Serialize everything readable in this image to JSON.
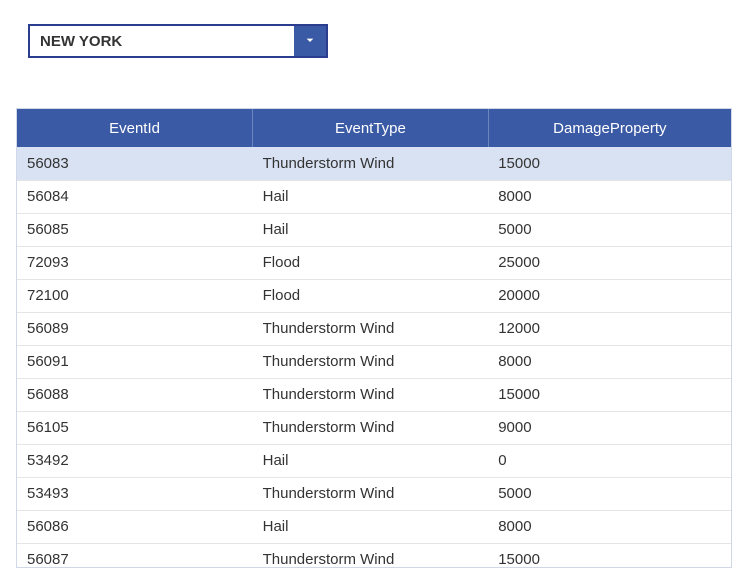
{
  "dropdown": {
    "value": "NEW YORK"
  },
  "table": {
    "columns": [
      "EventId",
      "EventType",
      "DamageProperty"
    ],
    "rows": [
      {
        "EventId": "56083",
        "EventType": "Thunderstorm Wind",
        "DamageProperty": "15000",
        "selected": true
      },
      {
        "EventId": "56084",
        "EventType": "Hail",
        "DamageProperty": "8000"
      },
      {
        "EventId": "56085",
        "EventType": "Hail",
        "DamageProperty": "5000"
      },
      {
        "EventId": "72093",
        "EventType": "Flood",
        "DamageProperty": "25000"
      },
      {
        "EventId": "72100",
        "EventType": "Flood",
        "DamageProperty": "20000"
      },
      {
        "EventId": "56089",
        "EventType": "Thunderstorm Wind",
        "DamageProperty": "12000"
      },
      {
        "EventId": "56091",
        "EventType": "Thunderstorm Wind",
        "DamageProperty": "8000"
      },
      {
        "EventId": "56088",
        "EventType": "Thunderstorm Wind",
        "DamageProperty": "15000"
      },
      {
        "EventId": "56105",
        "EventType": "Thunderstorm Wind",
        "DamageProperty": "9000"
      },
      {
        "EventId": "53492",
        "EventType": "Hail",
        "DamageProperty": "0"
      },
      {
        "EventId": "53493",
        "EventType": "Thunderstorm Wind",
        "DamageProperty": "5000"
      },
      {
        "EventId": "56086",
        "EventType": "Hail",
        "DamageProperty": "8000"
      },
      {
        "EventId": "56087",
        "EventType": "Thunderstorm Wind",
        "DamageProperty": "15000"
      }
    ]
  }
}
